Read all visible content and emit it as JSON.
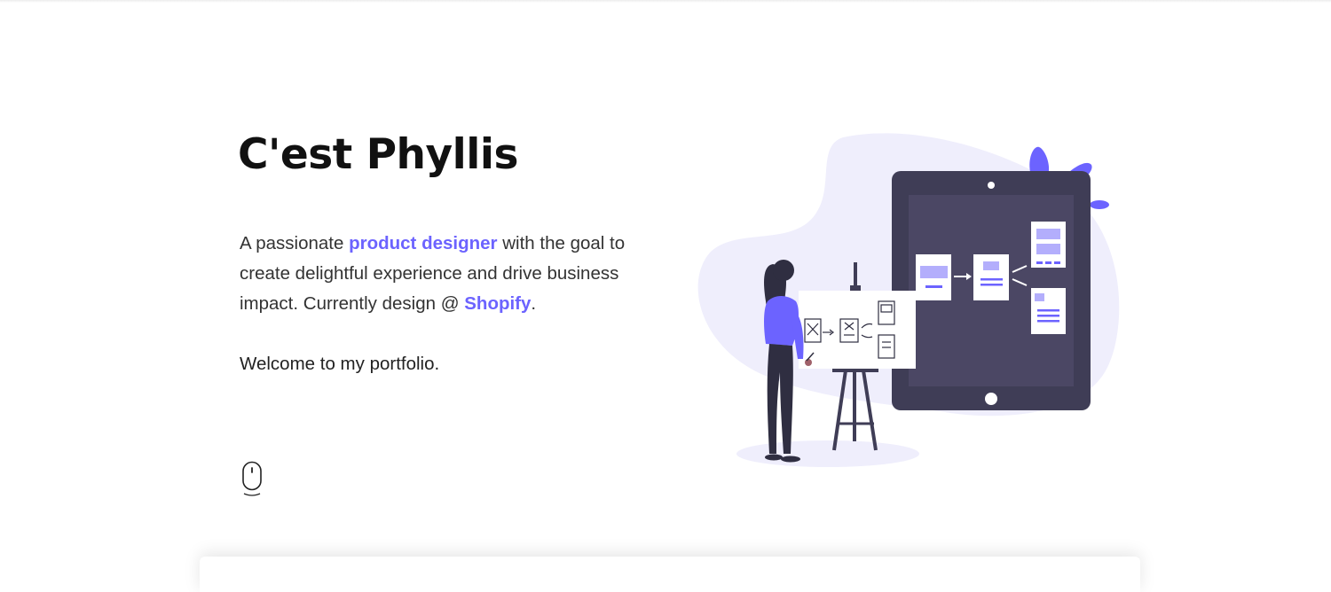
{
  "hero": {
    "title": "C'est Phyllis",
    "intro_part1": "A passionate ",
    "intro_link_role": "product designer",
    "intro_part2": " with the goal to create delightful experience and drive business impact. Currently design @ ",
    "intro_link_company": "Shopify",
    "intro_part3": ".",
    "welcome": "Welcome to my portfolio."
  },
  "icons": {
    "scroll": "mouse-scroll-icon"
  },
  "colors": {
    "accent": "#6c63ff",
    "blob": "#efeefc",
    "tablet_frame": "#3f3d56",
    "tablet_screen": "#4b4764",
    "text": "#111111"
  }
}
